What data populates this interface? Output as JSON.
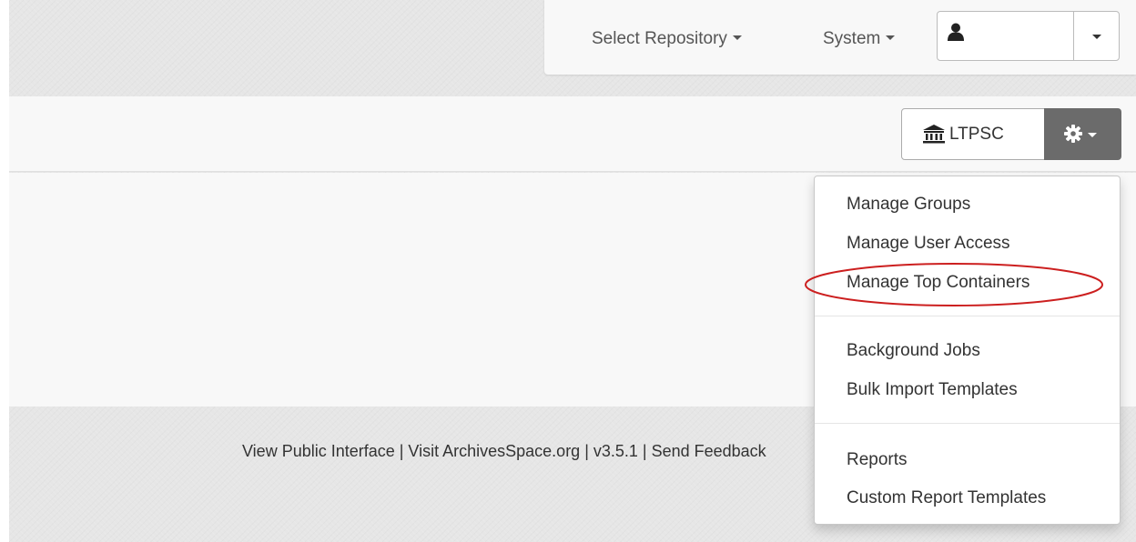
{
  "navbar": {
    "select_repository": "Select Repository",
    "system": "System",
    "user_icon": "user-icon"
  },
  "repository": {
    "name": "LTPSC",
    "icon": "institution-icon",
    "settings_icon": "gear-icon"
  },
  "settings_menu": {
    "groups": [
      [
        "Manage Groups",
        "Manage User Access",
        "Manage Top Containers"
      ],
      [
        "Background Jobs",
        "Bulk Import Templates"
      ],
      [
        "Reports",
        "Custom Report Templates"
      ]
    ],
    "highlighted_item": "Manage Top Containers",
    "highlight_color": "#cc1f1f"
  },
  "footer": {
    "text": "View Public Interface | Visit ArchivesSpace.org | v3.5.1 | Send Feedback"
  },
  "colors": {
    "gear_button_bg": "#6b6b6b",
    "page_bg": "#e6e6e6"
  }
}
